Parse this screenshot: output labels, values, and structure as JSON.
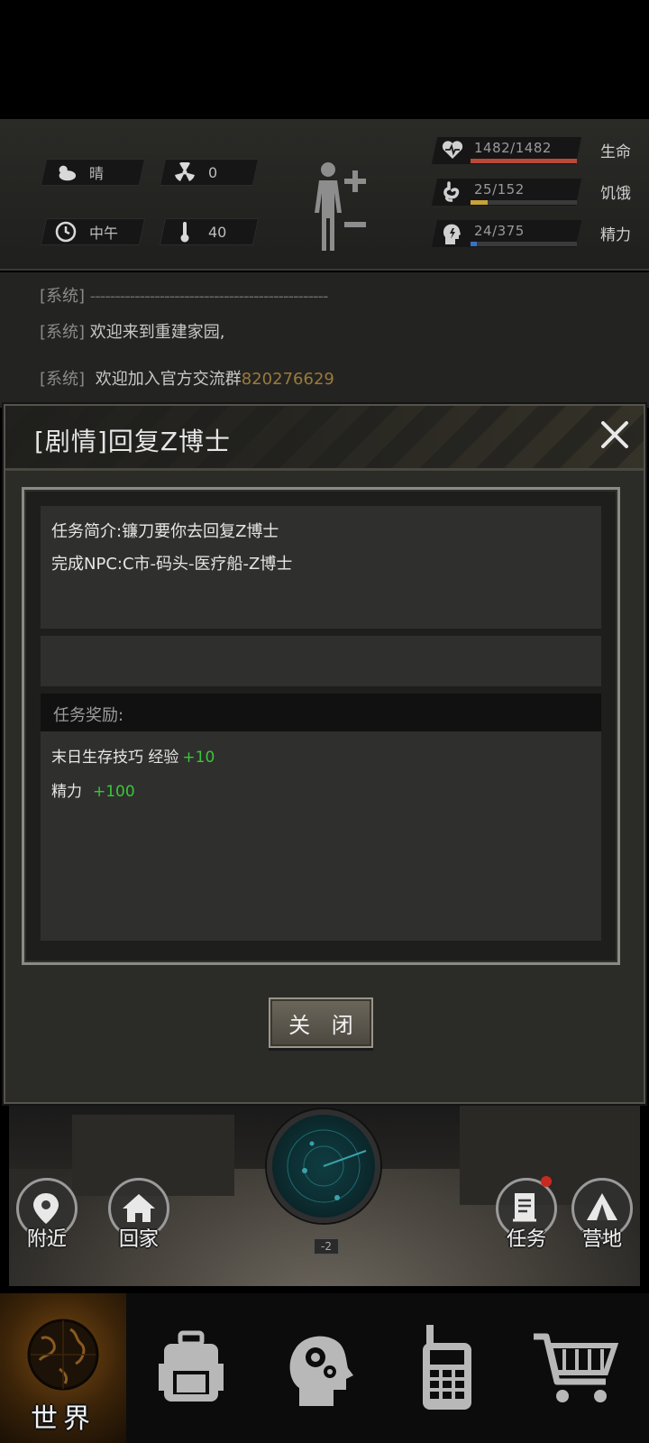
{
  "environment": {
    "weather": "晴",
    "radiation": "0",
    "time_of_day": "中午",
    "temperature": "40"
  },
  "stats": [
    {
      "name": "生命",
      "value": "1482/1482",
      "fraction": 1.0,
      "color": "#b94a3a",
      "icon": "heart-icon"
    },
    {
      "name": "饥饿",
      "value": "25/152",
      "fraction": 0.16,
      "color": "#c9a23a",
      "icon": "stomach-icon"
    },
    {
      "name": "精力",
      "value": "24/375",
      "fraction": 0.06,
      "color": "#3a6fc9",
      "icon": "energy-head-icon"
    }
  ],
  "chat": {
    "lines": [
      {
        "tag": "[系统]",
        "msg": "------------------------------------------------"
      },
      {
        "tag": "[系统]",
        "msg": "欢迎来到重建家园,"
      },
      {
        "tag": "[系统]",
        "msg": "欢迎加入官方交流群",
        "number": "820276629"
      }
    ]
  },
  "dialog": {
    "title": "[剧情]回复Z博士",
    "description": [
      "任务简介:镰刀要你去回复Z博士",
      "完成NPC:C市-码头-医疗船-Z博士"
    ],
    "reward_header": "任务奖励:",
    "rewards": [
      {
        "label": "末日生存技巧 经验",
        "amount": "+10"
      },
      {
        "label": "精力",
        "amount": "+100"
      }
    ],
    "close_button": "关 闭"
  },
  "map": {
    "radar_level": "-2",
    "buttons": [
      {
        "label": "附近",
        "icon": "location-pin-icon"
      },
      {
        "label": "回家",
        "icon": "home-icon"
      },
      {
        "label": "任务",
        "icon": "task-list-icon"
      },
      {
        "label": "营地",
        "icon": "tent-icon"
      }
    ]
  },
  "bottom_nav": {
    "items": [
      {
        "label": "世界",
        "icon": "globe-icon",
        "active": true
      },
      {
        "label": "",
        "icon": "backpack-icon"
      },
      {
        "label": "",
        "icon": "brain-gear-icon"
      },
      {
        "label": "",
        "icon": "radio-icon"
      },
      {
        "label": "",
        "icon": "cart-icon"
      }
    ]
  },
  "colors": {
    "reward_plus": "#39c63a",
    "group_number": "#9b7a3a"
  }
}
